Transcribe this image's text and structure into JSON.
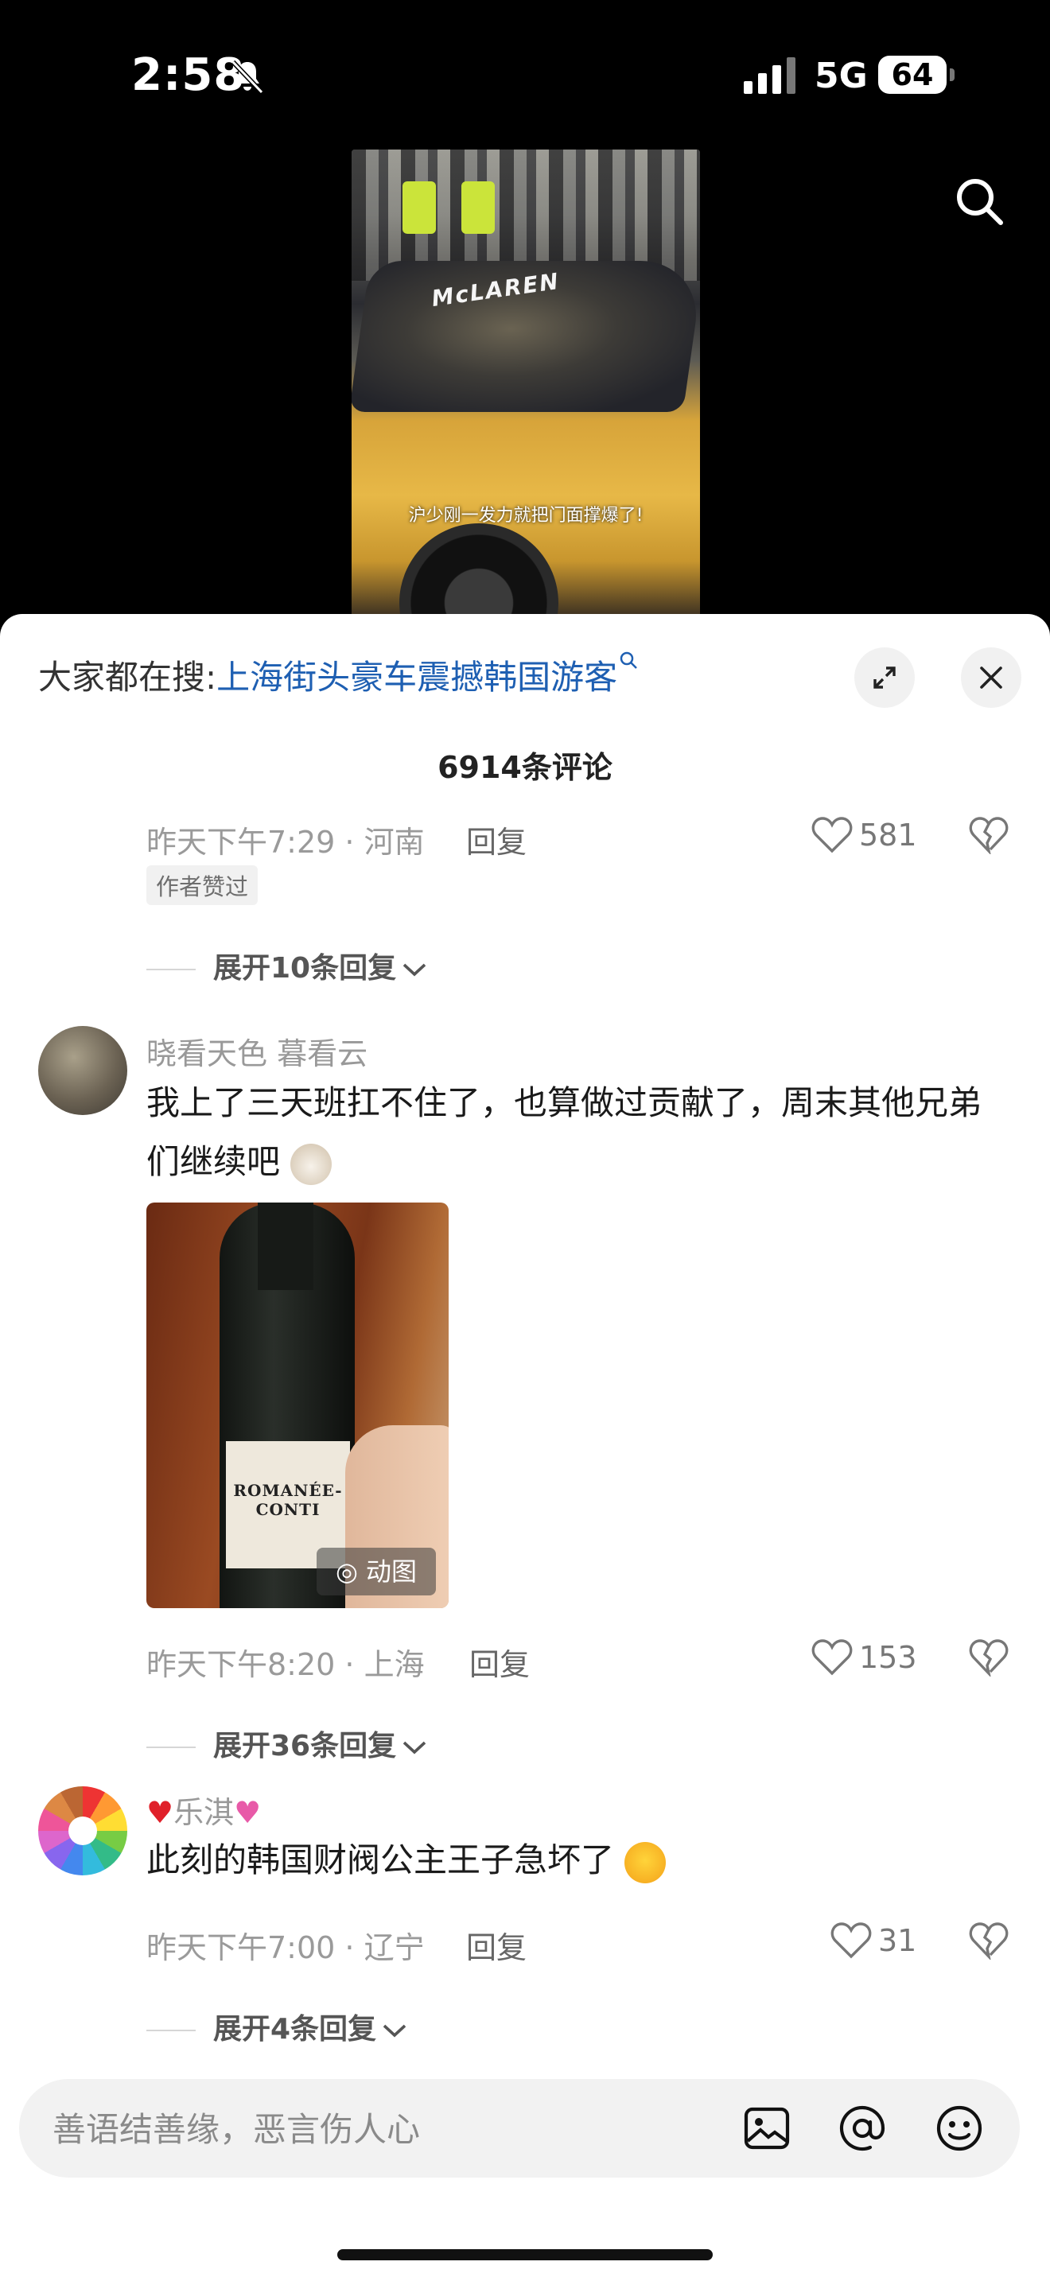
{
  "status_bar": {
    "time": "2:58",
    "network": "5G",
    "battery": "64"
  },
  "video": {
    "brand_text": "McLAREN",
    "subtitle": "沪少刚一发力就把门面撑爆了!"
  },
  "sheet": {
    "trending_prefix": "大家都在搜:",
    "trending_query": "上海街头豪车震撼韩国游客",
    "comment_count": "6914条评论"
  },
  "comments": [
    {
      "meta": "昨天下午7:29 · 河南",
      "reply_label": "回复",
      "likes": "581",
      "badge": "作者赞过",
      "expand": "展开10条回复"
    },
    {
      "username": "晓看天色 暮看云",
      "text": "我上了三天班扛不住了，也算做过贡献了，周末其他兄弟们继续吧",
      "image_label_text": "ROMANÉE-CONTI",
      "image_tag": "动图",
      "meta": "昨天下午8:20 · 上海",
      "reply_label": "回复",
      "likes": "153",
      "expand": "展开36条回复"
    },
    {
      "username": "乐淇",
      "text": "此刻的韩国财阀公主王子急坏了",
      "meta": "昨天下午7:00 · 辽宁",
      "reply_label": "回复",
      "likes": "31",
      "expand": "展开4条回复"
    }
  ],
  "input": {
    "placeholder": "善语结善缘，恶言伤人心"
  },
  "icons": [
    "bell-slash-icon",
    "signal-icon",
    "search-icon",
    "search-small-icon",
    "expand-icon",
    "close-icon",
    "heart-icon",
    "dislike-heart-icon",
    "chevron-down-icon",
    "gif-icon",
    "image-icon",
    "at-icon",
    "emoji-icon"
  ],
  "colors": {
    "link": "#1e5fb2",
    "sheet": "#ffffff",
    "meta": "#9a9a9a"
  }
}
